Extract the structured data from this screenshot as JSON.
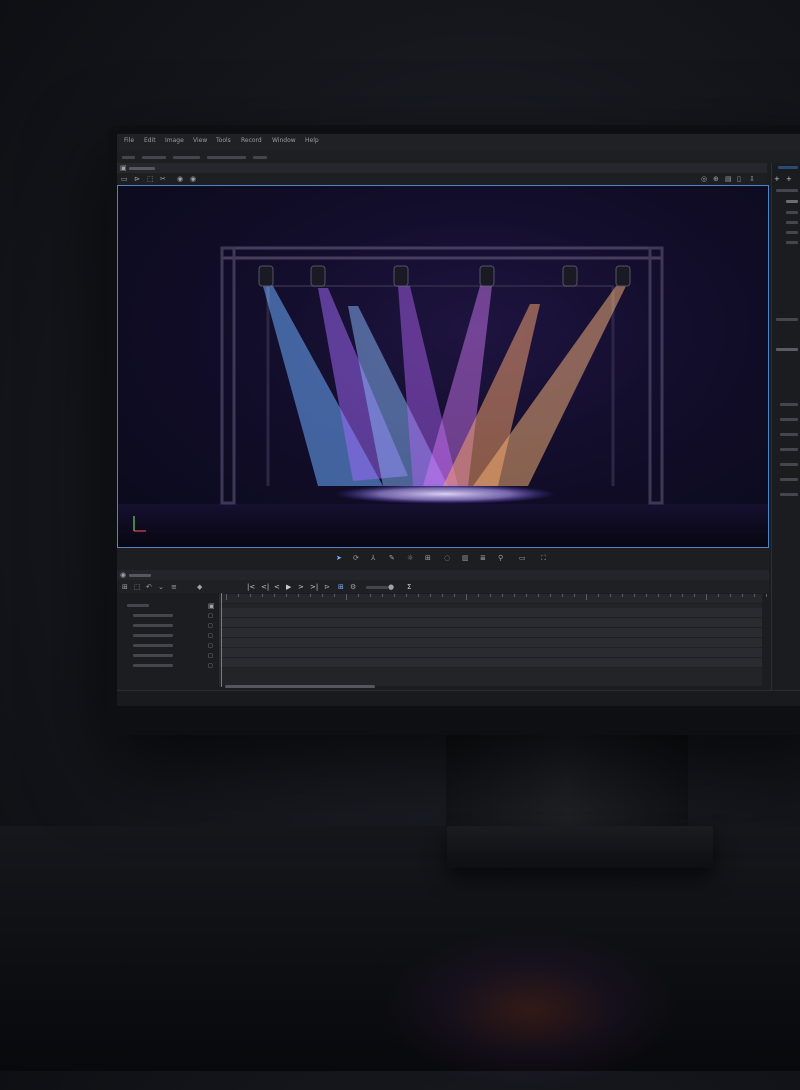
{
  "menubar": {
    "items": [
      "File",
      "Edit",
      "Image",
      "View",
      "Tools",
      "Record",
      "Window",
      "Help"
    ]
  },
  "viewport": {
    "beams": [
      {
        "color": "#5ea6ff"
      },
      {
        "color": "#9b62ff"
      },
      {
        "color": "#7fb6ff"
      },
      {
        "color": "#b05cff"
      },
      {
        "color": "#d873ff"
      },
      {
        "color": "#ffa24a"
      },
      {
        "color": "#ffb35c"
      }
    ],
    "spot_color": "#b8a4ff"
  },
  "controls": {
    "icons": [
      "select-icon",
      "rotate-icon",
      "axis-icon",
      "pen-icon",
      "light-icon",
      "grid-icon",
      "orbit-icon",
      "camera-icon",
      "layers-icon",
      "node-icon",
      "monitor-icon",
      "capture-icon"
    ]
  },
  "timeline": {
    "transport": [
      "|<",
      "<|",
      "<",
      "▶",
      ">",
      ">|"
    ],
    "script_label": "Σ"
  },
  "colors": {
    "accent": "#4c86c8"
  }
}
